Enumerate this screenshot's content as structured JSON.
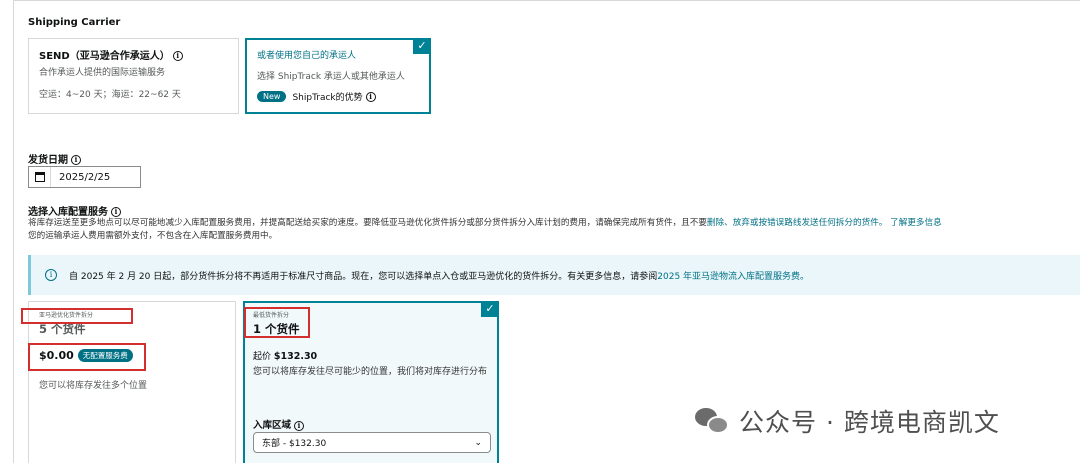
{
  "carrier": {
    "section_title": "Shipping Carrier",
    "send_card": {
      "title": "SEND（亚马逊合作承运人）",
      "subtitle": "合作承运人提供的国际运输服务",
      "transit": "空运：4~20 天；海运：22~62 天"
    },
    "own_card": {
      "title": "或者使用您自己的承运人",
      "subtitle": "选择 ShipTrack 承运人或其他承运人",
      "badge": "New",
      "link": "ShipTrack的优势"
    }
  },
  "ship_date": {
    "label": "发货日期",
    "value": "2025/2/25"
  },
  "placement": {
    "title": "选择入库配置服务",
    "desc_part1": "将库存运送至更多地点可以尽可能地减少入库配置服务费用，并提高配送给买家的速度。要降低亚马逊优化货件拆分或部分货件拆分入库计划的费用，请确保完成所有货件，且不要",
    "desc_link1": "删除、放弃或按错误路线发送任何拆分的货件。",
    "desc_link2": "了解更多信息",
    "desc_line2": "您的运输承运人费用需额外支付，不包含在入库配置服务费用中。"
  },
  "notice": {
    "text": "自 2025 年 2 月 20 日起，部分货件拆分将不再适用于标准尺寸商品。现在，您可以选择单点入仓或亚马逊优化的货件拆分。有关更多信息，请参阅",
    "link": "2025 年亚马逊物流入库配置服务费。"
  },
  "options": {
    "amazon": {
      "tag": "亚马逊优化货件拆分",
      "count": "5 个货件",
      "price": "$0.00",
      "fee_badge": "无配置服务费",
      "note": "您可以将库存发往多个位置"
    },
    "minimal": {
      "tag": "最低货件拆分",
      "count": "1 个货件",
      "price_prefix": "起价",
      "price": "$132.30",
      "desc": "您可以将库存发往尽可能少的位置，我们将对库存进行分布",
      "region_label": "入库区域",
      "region_value": "东部 - $132.30"
    }
  },
  "watermark": {
    "text": "公众号 · 跨境电商凯文"
  },
  "colors": {
    "accent": "#008296",
    "link": "#007185",
    "highlight": "#d32f2f",
    "notice_bg": "#eaf6fa"
  }
}
